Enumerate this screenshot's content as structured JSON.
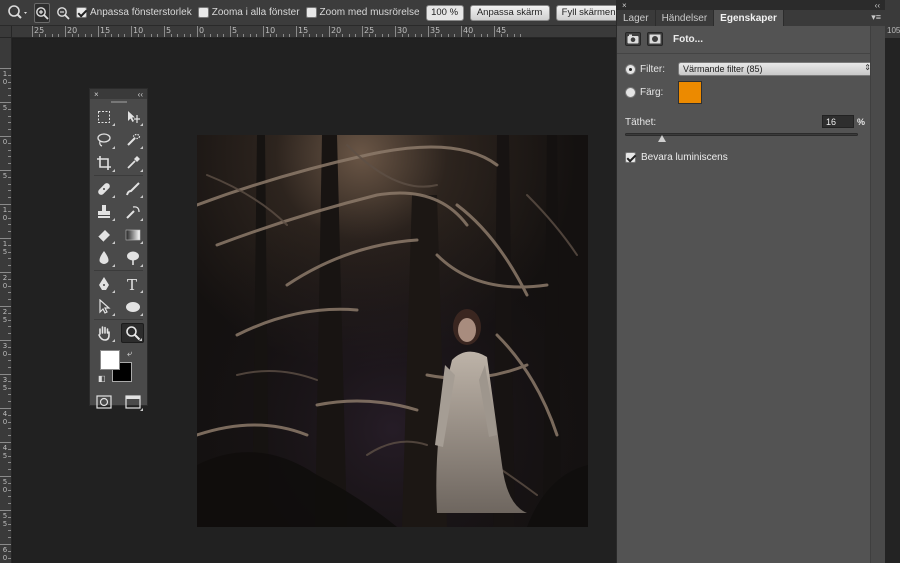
{
  "options_bar": {
    "resize_windows_label": "Anpassa fönsterstorlek",
    "resize_windows_checked": true,
    "zoom_all_label": "Zooma i alla fönster",
    "zoom_all_checked": false,
    "scrubby_zoom_label": "Zoom med musrörelse",
    "scrubby_zoom_checked": false,
    "zoom_level": "100 %",
    "fit_screen_label": "Anpassa skärm",
    "fill_screen_label": "Fyll skärmen"
  },
  "ruler_top": [
    "25",
    "20",
    "15",
    "10",
    "5",
    "0",
    "5",
    "10",
    "15",
    "20",
    "25",
    "30",
    "35",
    "40",
    "45"
  ],
  "ruler_left": [
    "1\n0",
    "5",
    "0",
    "5",
    "1\n0",
    "1\n5",
    "2\n0",
    "2\n5",
    "3\n0",
    "3\n5",
    "4\n0",
    "4\n5",
    "5\n0",
    "5\n5",
    "6\n0"
  ],
  "edge_ruler": "105",
  "tools_panel": {
    "close": "×",
    "collapse": "‹‹"
  },
  "panel": {
    "close": "×",
    "collapse": "‹‹",
    "tabs": [
      {
        "label": "Lager",
        "active": false
      },
      {
        "label": "Händelser",
        "active": false
      },
      {
        "label": "Egenskaper",
        "active": true
      }
    ],
    "menu_icon": "▾≡"
  },
  "properties": {
    "title": "Foto...",
    "filter_label": "Filter:",
    "filter_value": "Värmande filter (85)",
    "color_label": "Färg:",
    "color_value": "#ec8a00",
    "density_label": "Täthet:",
    "density_value": "16",
    "density_unit": "%",
    "density_fraction": 0.16,
    "preserve_luminosity_label": "Bevara luminiscens",
    "preserve_luminosity_checked": true
  },
  "colors": {
    "foreground": "#ffffff",
    "background": "#000000"
  }
}
